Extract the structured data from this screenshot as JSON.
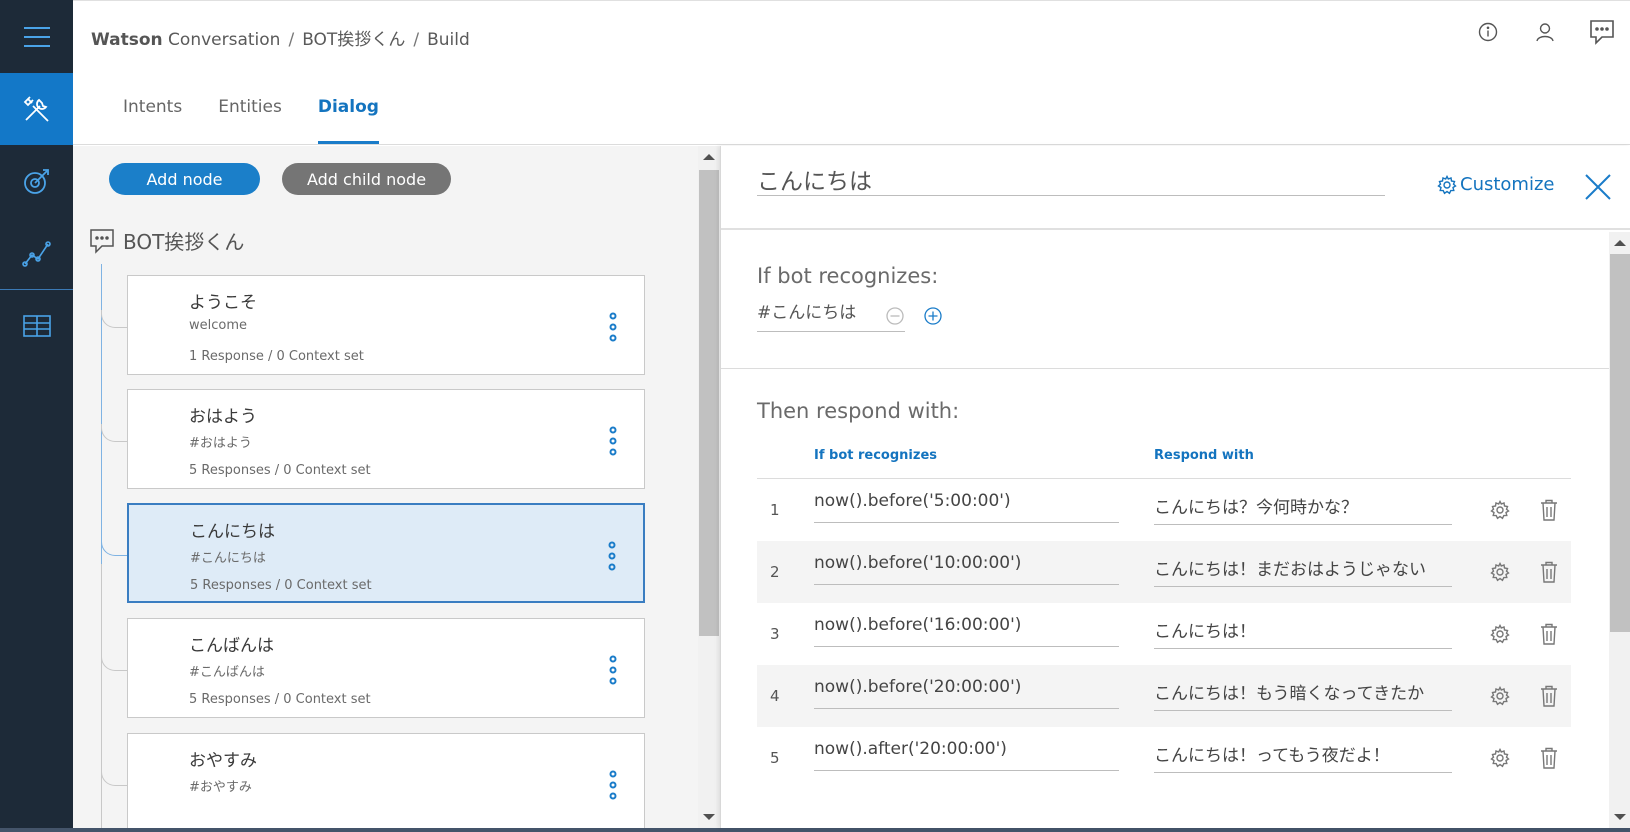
{
  "breadcrumb": {
    "product_bold": "Watson",
    "product_rest": " Conversation",
    "separator": "/",
    "workspace": "BOT挨拶くん",
    "page": "Build"
  },
  "tabs": [
    {
      "label": "Intents"
    },
    {
      "label": "Entities"
    },
    {
      "label": "Dialog",
      "active": true
    }
  ],
  "toolbar": {
    "add_node_label": "Add node",
    "add_child_node_label": "Add child node"
  },
  "tree": {
    "root_label": "BOT挨拶くん",
    "nodes": [
      {
        "title": "ようこそ",
        "condition": "welcome",
        "meta": "1 Response / 0 Context set"
      },
      {
        "title": "おはよう",
        "condition": "#おはよう",
        "meta": "5 Responses / 0 Context set"
      },
      {
        "title": "こんにちは",
        "condition": "#こんにちは",
        "meta": "5 Responses / 0 Context set",
        "selected": true
      },
      {
        "title": "こんばんは",
        "condition": "#こんばんは",
        "meta": "5 Responses / 0 Context set"
      },
      {
        "title": "おやすみ",
        "condition": "#おやすみ",
        "meta": ""
      }
    ]
  },
  "editor": {
    "node_name": "こんにちは",
    "customize_label": "Customize",
    "if_label": "If bot recognizes:",
    "condition_value": "#こんにちは",
    "then_label": "Then respond with:",
    "table_headers": {
      "condition": "If bot recognizes",
      "response": "Respond with"
    },
    "responses": [
      {
        "num": "1",
        "condition": "now().before('5:00:00')",
        "response": "こんにちは？今何時かな？"
      },
      {
        "num": "2",
        "condition": "now().before('10:00:00')",
        "response": "こんにちは！まだおはようじゃない"
      },
      {
        "num": "3",
        "condition": "now().before('16:00:00')",
        "response": "こんにちは！"
      },
      {
        "num": "4",
        "condition": "now().before('20:00:00')",
        "response": "こんにちは！もう暗くなってきたか"
      },
      {
        "num": "5",
        "condition": "now().after('20:00:00')",
        "response": "こんにちは！ってもう夜だよ！"
      }
    ]
  },
  "icons": {
    "menu": "hamburger-menu-icon",
    "build": "tools-icon",
    "improve": "target-icon",
    "analytics": "line-chart-icon",
    "deploy": "grid-icon",
    "info": "info-icon",
    "user": "user-icon",
    "chat": "chat-icon"
  },
  "colors": {
    "rail": "#1d2a38",
    "accent": "#1b7fc9",
    "selected_node": "#deebf7"
  }
}
